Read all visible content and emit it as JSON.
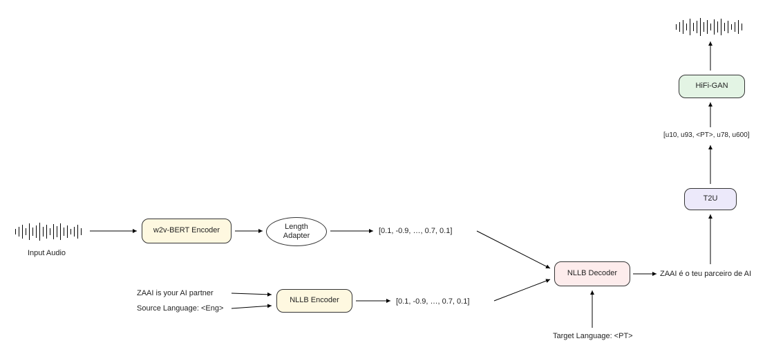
{
  "nodes": {
    "input_audio_label": "Input Audio",
    "w2v_bert": "w2v-BERT Encoder",
    "length_adapter": "Length\nAdapter",
    "vec_top": "[0.1, -0.9, …, 0.7, 0.1]",
    "text_input": "ZAAI is your AI partner",
    "source_lang": "Source Language: <Eng>",
    "nllb_encoder": "NLLB Encoder",
    "vec_bottom": "[0.1, -0.9, …, 0.7, 0.1]",
    "nllb_decoder": "NLLB Decoder",
    "target_lang": "Target Language: <PT>",
    "decoded_text": "ZAAI é o teu parceiro de AI",
    "t2u": "T2U",
    "units": "[u10, u93, <PT>, u78, u600]",
    "hifigan": "HiFi-GAN"
  }
}
